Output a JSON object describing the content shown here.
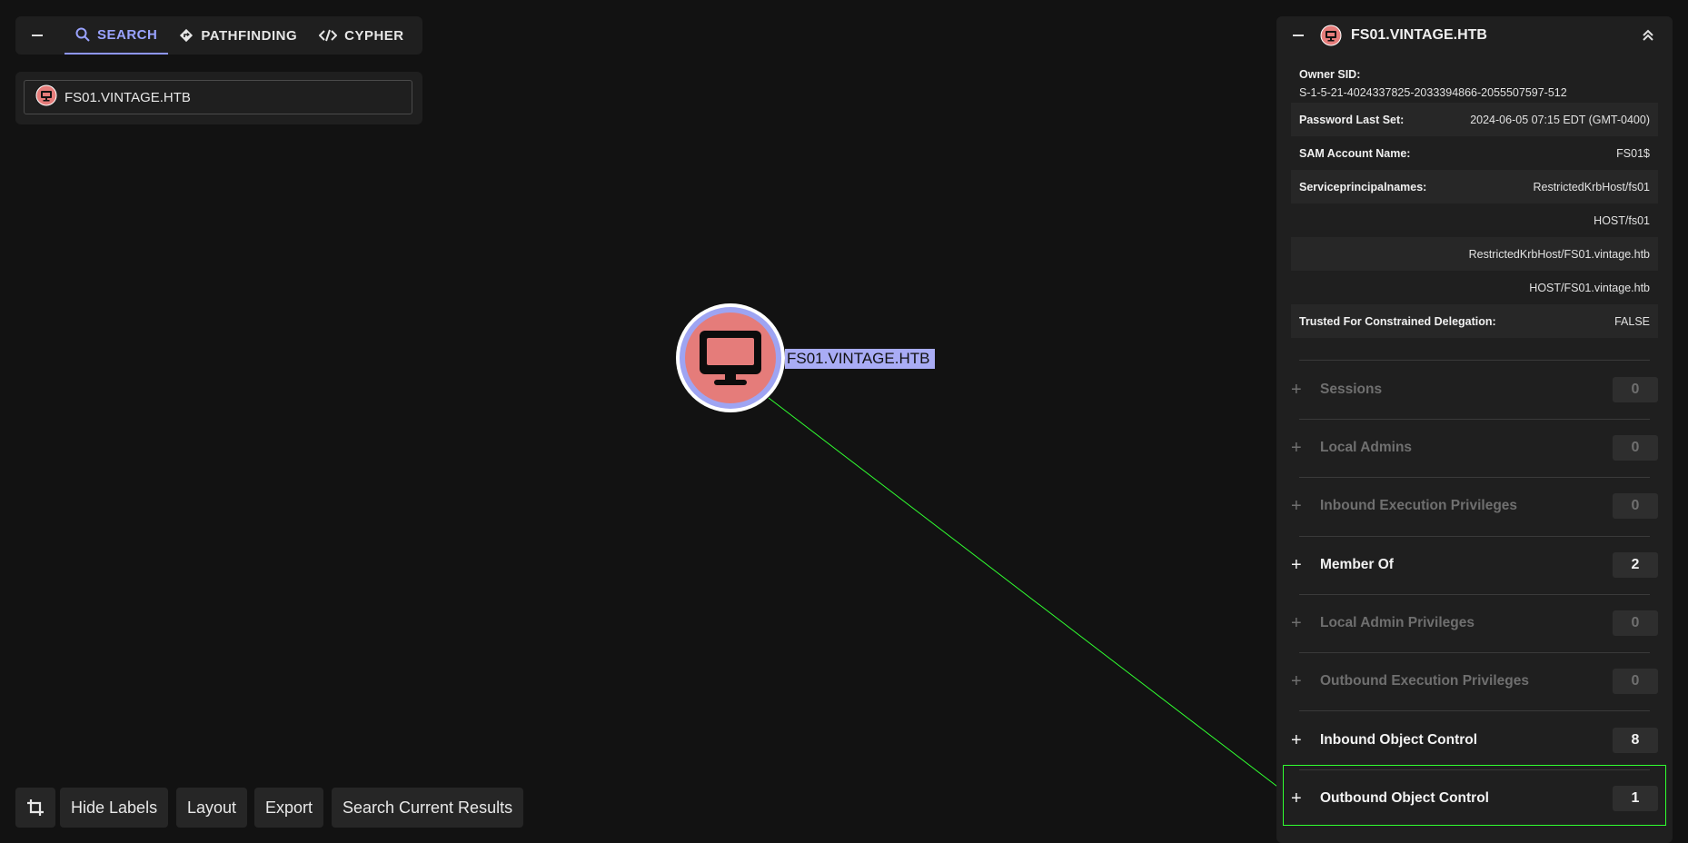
{
  "nav": {
    "tabs": [
      {
        "label": "SEARCH",
        "icon": "search-icon",
        "active": true
      },
      {
        "label": "PATHFINDING",
        "icon": "diamond-route-icon",
        "active": false
      },
      {
        "label": "CYPHER",
        "icon": "code-icon",
        "active": false
      }
    ]
  },
  "search": {
    "value": "FS01.VINTAGE.HTB",
    "icon": "computer-icon"
  },
  "graph": {
    "node_label": "FS01.VINTAGE.HTB",
    "node_color": "#e57c7a",
    "ring_color": "#9ea4f2",
    "edge_color": "#30ff30"
  },
  "toolbar": {
    "crop_icon": "crop-icon",
    "hide_labels": "Hide Labels",
    "layout": "Layout",
    "export": "Export",
    "search_current": "Search Current Results"
  },
  "panel": {
    "title": "FS01.VINTAGE.HTB",
    "owner_sid_label": "Owner SID:",
    "owner_sid_value": "S-1-5-21-4024337825-2033394866-2055507597-512",
    "props": [
      {
        "key": "Password Last Set:",
        "value": "2024-06-05 07:15 EDT (GMT-0400)"
      },
      {
        "key": "SAM Account Name:",
        "value": "FS01$"
      },
      {
        "key": "Serviceprincipalnames:",
        "value": "RestrictedKrbHost/fs01"
      },
      {
        "key": "",
        "value": "HOST/fs01"
      },
      {
        "key": "",
        "value": "RestrictedKrbHost/FS01.vintage.htb"
      },
      {
        "key": "",
        "value": "HOST/FS01.vintage.htb"
      },
      {
        "key": "Trusted For Constrained Delegation:",
        "value": "FALSE"
      }
    ],
    "sections": [
      {
        "label": "Sessions",
        "count": "0",
        "enabled": false
      },
      {
        "label": "Local Admins",
        "count": "0",
        "enabled": false
      },
      {
        "label": "Inbound Execution Privileges",
        "count": "0",
        "enabled": false
      },
      {
        "label": "Member Of",
        "count": "2",
        "enabled": true
      },
      {
        "label": "Local Admin Privileges",
        "count": "0",
        "enabled": false
      },
      {
        "label": "Outbound Execution Privileges",
        "count": "0",
        "enabled": false
      },
      {
        "label": "Inbound Object Control",
        "count": "8",
        "enabled": true
      },
      {
        "label": "Outbound Object Control",
        "count": "1",
        "enabled": true
      }
    ]
  }
}
